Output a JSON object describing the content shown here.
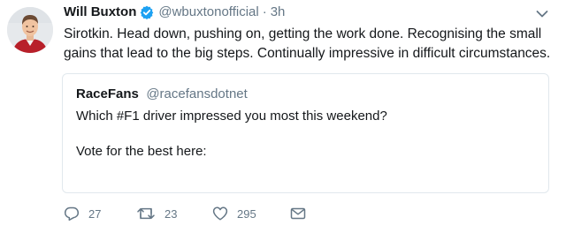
{
  "tweet": {
    "author_name": "Will Buxton",
    "author_handle": "@wbuxtonofficial",
    "separator": "·",
    "time": "3h",
    "text": "Sirotkin. Head down, pushing on, getting the work done. Recognising the small gains that lead to the big steps. Continually impressive in difficult circumstances."
  },
  "quoted_tweet": {
    "author_name": "RaceFans",
    "author_handle": "@racefansdotnet",
    "line1": "Which #F1 driver impressed you most this weekend?",
    "line2": "Vote for the best here:"
  },
  "actions": {
    "reply_count": "27",
    "retweet_count": "23",
    "like_count": "295"
  },
  "icons": {
    "verified": "verified-badge-icon",
    "caret": "chevron-down-icon",
    "reply": "reply-icon",
    "retweet": "retweet-icon",
    "like": "heart-icon",
    "message": "envelope-icon"
  },
  "colors": {
    "verified": "#1da1f2",
    "secondary_text": "#657786",
    "primary_text": "#14171a",
    "border": "#e1e8ed"
  }
}
